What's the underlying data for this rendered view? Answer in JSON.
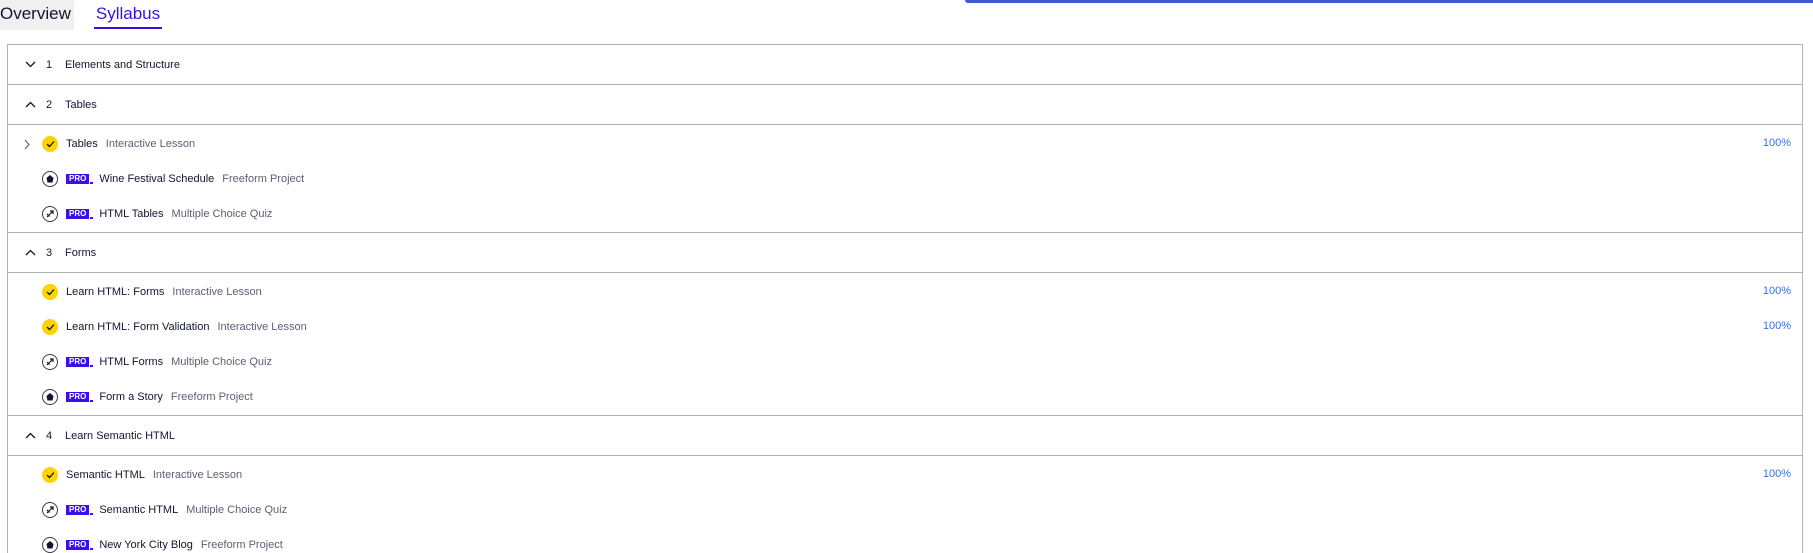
{
  "tabs": [
    {
      "label": "Overview"
    },
    {
      "label": "Syllabus"
    }
  ],
  "pro_label": "PRO",
  "modules": [
    {
      "number": "1",
      "title": "Elements and Structure",
      "expanded": false,
      "lessons": []
    },
    {
      "number": "2",
      "title": "Tables",
      "expanded": true,
      "lessons": [
        {
          "title": "Tables",
          "type": "Interactive Lesson",
          "status": "done",
          "pro": false,
          "progress": "100%",
          "has_expand": true
        },
        {
          "title": "Wine Festival Schedule",
          "type": "Freeform Project",
          "status": "project",
          "pro": true,
          "progress": ""
        },
        {
          "title": "HTML Tables",
          "type": "Multiple Choice Quiz",
          "status": "quiz",
          "pro": true,
          "progress": ""
        }
      ]
    },
    {
      "number": "3",
      "title": "Forms",
      "expanded": true,
      "lessons": [
        {
          "title": "Learn HTML: Forms",
          "type": "Interactive Lesson",
          "status": "done",
          "pro": false,
          "progress": "100%"
        },
        {
          "title": "Learn HTML: Form Validation",
          "type": "Interactive Lesson",
          "status": "done",
          "pro": false,
          "progress": "100%"
        },
        {
          "title": "HTML Forms",
          "type": "Multiple Choice Quiz",
          "status": "quiz",
          "pro": true,
          "progress": ""
        },
        {
          "title": "Form a Story",
          "type": "Freeform Project",
          "status": "project",
          "pro": true,
          "progress": ""
        }
      ]
    },
    {
      "number": "4",
      "title": "Learn Semantic HTML",
      "expanded": true,
      "lessons": [
        {
          "title": "Semantic HTML",
          "type": "Interactive Lesson",
          "status": "done",
          "pro": false,
          "progress": "100%"
        },
        {
          "title": "Semantic HTML",
          "type": "Multiple Choice Quiz",
          "status": "quiz",
          "pro": true,
          "progress": ""
        },
        {
          "title": "New York City Blog",
          "type": "Freeform Project",
          "status": "project",
          "pro": true,
          "progress": ""
        }
      ]
    }
  ],
  "colors": {
    "accent": "#3a10e5",
    "done": "#ffd300",
    "progress_link": "#3a6fd8",
    "top_bar": "#3a5bd1"
  }
}
